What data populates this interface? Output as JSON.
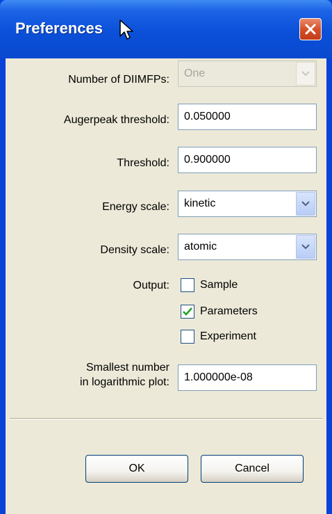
{
  "window": {
    "title": "Preferences"
  },
  "fields": {
    "diimfps": {
      "label": "Number of DIIMFPs:",
      "value": "One"
    },
    "augerpeak": {
      "label": "Augerpeak threshold:",
      "value": "0.050000"
    },
    "threshold": {
      "label": "Threshold:",
      "value": "0.900000"
    },
    "energy_scale": {
      "label": "Energy scale:",
      "value": "kinetic"
    },
    "density_scale": {
      "label": "Density scale:",
      "value": "atomic"
    },
    "smallest": {
      "label_line1": "Smallest number",
      "label_line2": "in logarithmic plot:",
      "value": "1.000000e-08"
    }
  },
  "output": {
    "label": "Output:",
    "options": [
      {
        "label": "Sample",
        "checked": false
      },
      {
        "label": "Parameters",
        "checked": true
      },
      {
        "label": "Experiment",
        "checked": false
      }
    ]
  },
  "buttons": {
    "ok": "OK",
    "cancel": "Cancel"
  },
  "colors": {
    "title_bar": "#0a50d8",
    "client_bg": "#ece9d8",
    "close_button": "#d5502a",
    "check_mark": "#21a121"
  }
}
